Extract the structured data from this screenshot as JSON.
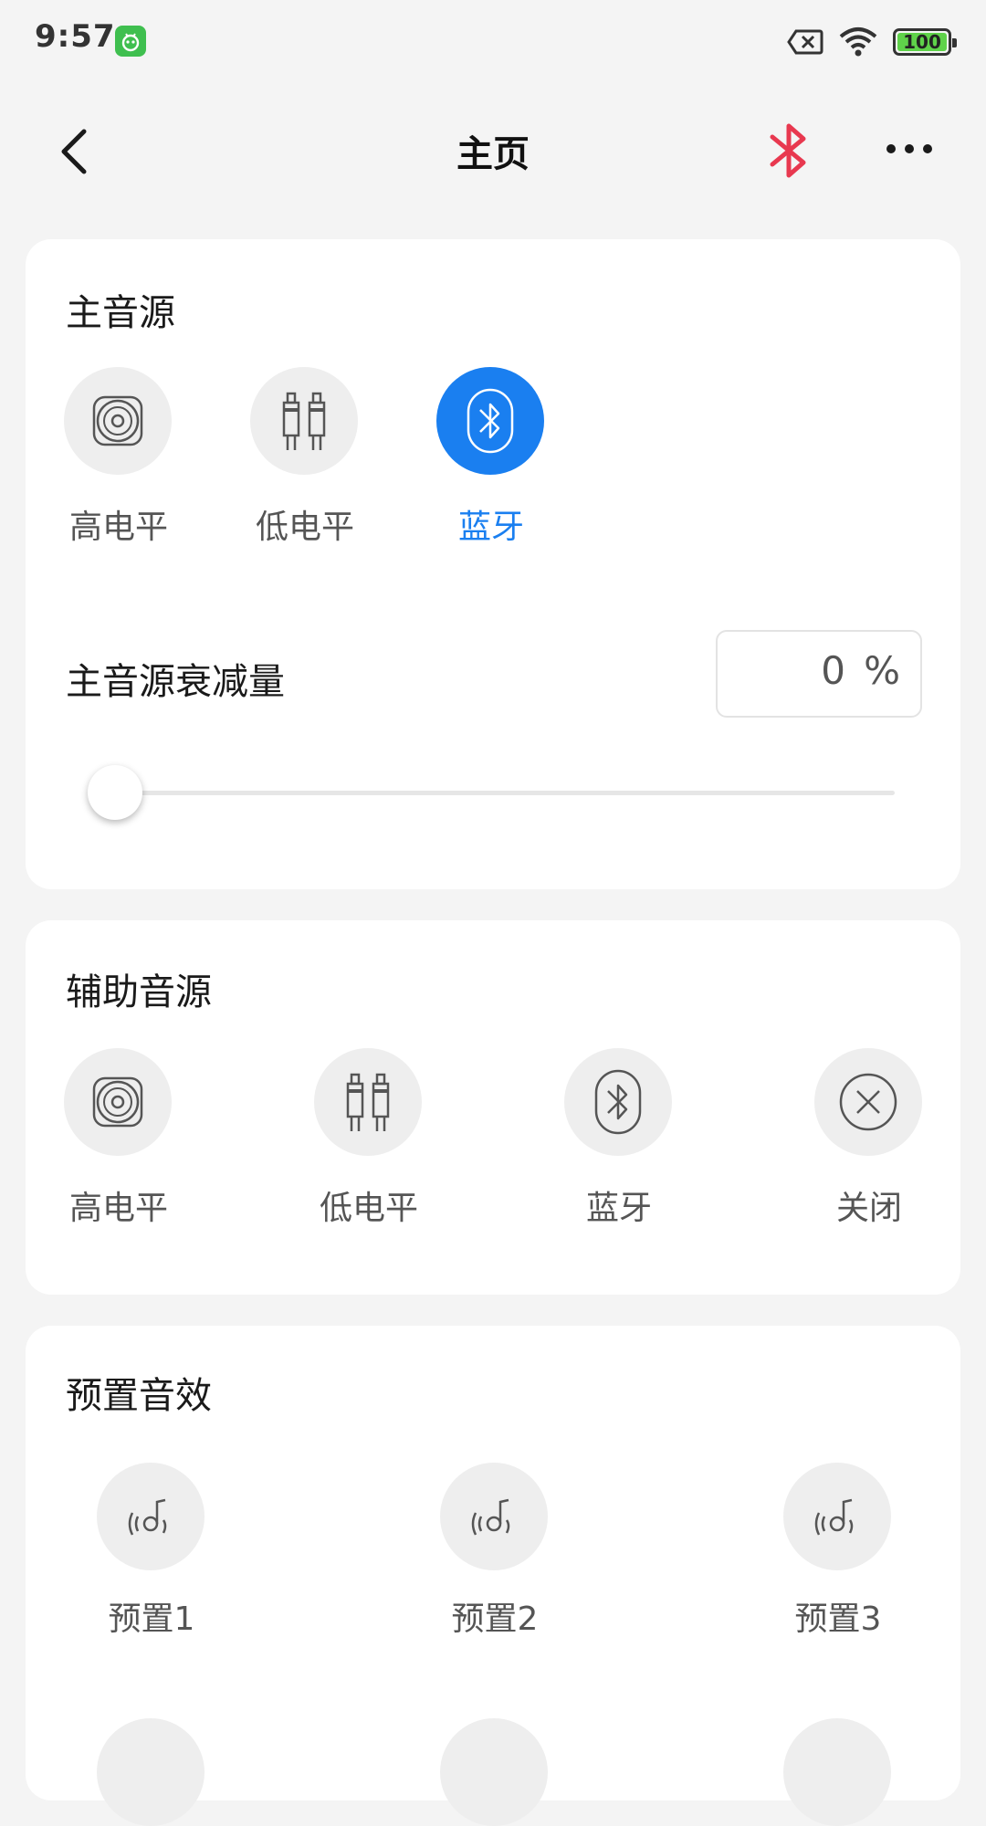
{
  "status_bar": {
    "time": "9:57",
    "battery": "100",
    "icons": [
      "app-notification-icon",
      "sim-x-icon",
      "wifi-icon",
      "battery-icon"
    ]
  },
  "nav": {
    "title": "主页",
    "back_icon": "chevron-left-icon",
    "bluetooth_icon": "bluetooth-icon",
    "more_icon": "more-dots-icon",
    "bluetooth_color": "#e8384f"
  },
  "main_source": {
    "title": "主音源",
    "options": [
      {
        "label": "高电平",
        "icon": "speaker-icon",
        "selected": false
      },
      {
        "label": "低电平",
        "icon": "rca-plug-icon",
        "selected": false
      },
      {
        "label": "蓝牙",
        "icon": "bluetooth-icon",
        "selected": true
      }
    ],
    "attenuation_label": "主音源衰减量",
    "attenuation_value": "0",
    "attenuation_unit": "%",
    "slider_value": 0,
    "accent_color": "#1a7ff0"
  },
  "aux_source": {
    "title": "辅助音源",
    "options": [
      {
        "label": "高电平",
        "icon": "speaker-icon"
      },
      {
        "label": "低电平",
        "icon": "rca-plug-icon"
      },
      {
        "label": "蓝牙",
        "icon": "bluetooth-icon"
      },
      {
        "label": "关闭",
        "icon": "close-circle-icon"
      }
    ]
  },
  "presets": {
    "title": "预置音效",
    "items": [
      {
        "label": "预置1",
        "icon": "sound-note-icon"
      },
      {
        "label": "预置2",
        "icon": "sound-note-icon"
      },
      {
        "label": "预置3",
        "icon": "sound-note-icon"
      }
    ]
  }
}
